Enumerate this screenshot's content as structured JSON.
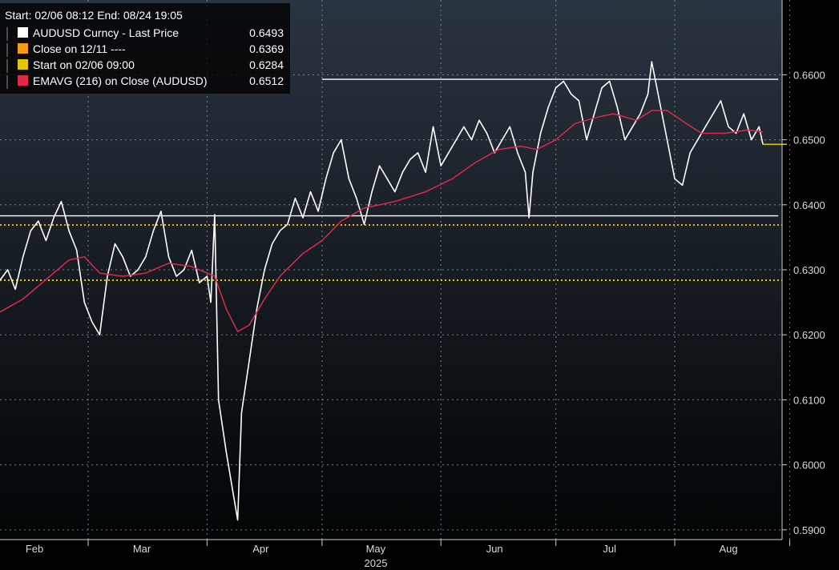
{
  "header": {
    "range_text": "Start: 02/06 08:12 End: 08/24 19:05"
  },
  "legend": {
    "items": [
      {
        "label": "AUDUSD Curncy - Last Price",
        "value": "0.6493",
        "color": "#ffffff"
      },
      {
        "label": "Close on 12/11 ----",
        "value": "0.6369",
        "color": "#f39c12"
      },
      {
        "label": "Start on 02/06 09:00",
        "value": "0.6284",
        "color": "#e5c700"
      },
      {
        "label": "EMAVG (216)  on Close (AUDUSD)",
        "value": "0.6512",
        "color": "#e0284a"
      }
    ]
  },
  "colors": {
    "price": "#ffffff",
    "ema": "#e0284a",
    "close_ref": "#f5a623",
    "start_ref": "#e5c700",
    "grid": "#8c9aa6",
    "background_top": "#2a3440",
    "background_bottom": "#020405"
  },
  "chart_data": {
    "type": "line",
    "title": "",
    "xlabel": "2025",
    "ylabel": "",
    "ylim": [
      0.5885,
      0.6715
    ],
    "x_range": [
      "2025-02-06",
      "2025-08-29"
    ],
    "grid": true,
    "legend_position": "top-left",
    "y_ticks": [
      "0.5900",
      "0.6000",
      "0.6100",
      "0.6200",
      "0.6300",
      "0.6400",
      "0.6500",
      "0.6600"
    ],
    "month_ticks": [
      {
        "label": "Feb",
        "date": "2025-02-15"
      },
      {
        "label": "Mar",
        "date": "2025-03-15"
      },
      {
        "label": "Apr",
        "date": "2025-04-15"
      },
      {
        "label": "May",
        "date": "2025-05-15"
      },
      {
        "label": "Jun",
        "date": "2025-06-15"
      },
      {
        "label": "Jul",
        "date": "2025-07-15"
      },
      {
        "label": "Aug",
        "date": "2025-08-15"
      }
    ],
    "month_dividers": [
      "2025-03-01",
      "2025-04-01",
      "2025-05-01",
      "2025-06-01",
      "2025-07-01",
      "2025-08-01",
      "2025-08-31"
    ],
    "horizontal_lines": [
      {
        "name": "resistance",
        "value": 0.6593,
        "from": "2025-05-01",
        "to": "2025-08-28",
        "style": "solid"
      },
      {
        "name": "support",
        "value": 0.6383,
        "from": "2025-02-06",
        "to": "2025-08-28",
        "style": "solid"
      },
      {
        "name": "close-ref",
        "value": 0.6369,
        "style": "dotted"
      },
      {
        "name": "start-ref",
        "value": 0.6284,
        "style": "dotted"
      }
    ],
    "last_price_marker": 0.6493,
    "series": [
      {
        "name": "AUDUSD Curncy - Last Price",
        "points": [
          [
            "2025-02-06",
            0.6284
          ],
          [
            "2025-02-08",
            0.63
          ],
          [
            "2025-02-10",
            0.627
          ],
          [
            "2025-02-12",
            0.632
          ],
          [
            "2025-02-14",
            0.636
          ],
          [
            "2025-02-16",
            0.6375
          ],
          [
            "2025-02-18",
            0.6345
          ],
          [
            "2025-02-20",
            0.638
          ],
          [
            "2025-02-22",
            0.6405
          ],
          [
            "2025-02-24",
            0.636
          ],
          [
            "2025-02-26",
            0.633
          ],
          [
            "2025-02-28",
            0.625
          ],
          [
            "2025-03-02",
            0.622
          ],
          [
            "2025-03-04",
            0.62
          ],
          [
            "2025-03-06",
            0.629
          ],
          [
            "2025-03-08",
            0.634
          ],
          [
            "2025-03-10",
            0.632
          ],
          [
            "2025-03-12",
            0.629
          ],
          [
            "2025-03-14",
            0.63
          ],
          [
            "2025-03-16",
            0.632
          ],
          [
            "2025-03-18",
            0.636
          ],
          [
            "2025-03-20",
            0.639
          ],
          [
            "2025-03-22",
            0.632
          ],
          [
            "2025-03-24",
            0.629
          ],
          [
            "2025-03-26",
            0.63
          ],
          [
            "2025-03-28",
            0.633
          ],
          [
            "2025-03-30",
            0.628
          ],
          [
            "2025-04-01",
            0.629
          ],
          [
            "2025-04-02",
            0.625
          ],
          [
            "2025-04-03",
            0.6385
          ],
          [
            "2025-04-04",
            0.61
          ],
          [
            "2025-04-06",
            0.602
          ],
          [
            "2025-04-08",
            0.595
          ],
          [
            "2025-04-09",
            0.5915
          ],
          [
            "2025-04-10",
            0.608
          ],
          [
            "2025-04-12",
            0.616
          ],
          [
            "2025-04-14",
            0.624
          ],
          [
            "2025-04-16",
            0.63
          ],
          [
            "2025-04-18",
            0.634
          ],
          [
            "2025-04-20",
            0.636
          ],
          [
            "2025-04-22",
            0.637
          ],
          [
            "2025-04-24",
            0.641
          ],
          [
            "2025-04-26",
            0.638
          ],
          [
            "2025-04-28",
            0.642
          ],
          [
            "2025-04-30",
            0.639
          ],
          [
            "2025-05-02",
            0.644
          ],
          [
            "2025-05-04",
            0.648
          ],
          [
            "2025-05-06",
            0.65
          ],
          [
            "2025-05-08",
            0.644
          ],
          [
            "2025-05-10",
            0.641
          ],
          [
            "2025-05-12",
            0.637
          ],
          [
            "2025-05-14",
            0.642
          ],
          [
            "2025-05-16",
            0.646
          ],
          [
            "2025-05-18",
            0.644
          ],
          [
            "2025-05-20",
            0.642
          ],
          [
            "2025-05-22",
            0.645
          ],
          [
            "2025-05-24",
            0.647
          ],
          [
            "2025-05-26",
            0.648
          ],
          [
            "2025-05-28",
            0.645
          ],
          [
            "2025-05-30",
            0.652
          ],
          [
            "2025-06-01",
            0.646
          ],
          [
            "2025-06-03",
            0.648
          ],
          [
            "2025-06-05",
            0.65
          ],
          [
            "2025-06-07",
            0.652
          ],
          [
            "2025-06-09",
            0.65
          ],
          [
            "2025-06-11",
            0.653
          ],
          [
            "2025-06-13",
            0.651
          ],
          [
            "2025-06-15",
            0.648
          ],
          [
            "2025-06-17",
            0.65
          ],
          [
            "2025-06-19",
            0.652
          ],
          [
            "2025-06-21",
            0.648
          ],
          [
            "2025-06-23",
            0.645
          ],
          [
            "2025-06-24",
            0.638
          ],
          [
            "2025-06-25",
            0.645
          ],
          [
            "2025-06-27",
            0.651
          ],
          [
            "2025-06-29",
            0.655
          ],
          [
            "2025-07-01",
            0.658
          ],
          [
            "2025-07-03",
            0.659
          ],
          [
            "2025-07-05",
            0.657
          ],
          [
            "2025-07-07",
            0.656
          ],
          [
            "2025-07-09",
            0.65
          ],
          [
            "2025-07-11",
            0.654
          ],
          [
            "2025-07-13",
            0.658
          ],
          [
            "2025-07-15",
            0.659
          ],
          [
            "2025-07-17",
            0.655
          ],
          [
            "2025-07-19",
            0.65
          ],
          [
            "2025-07-21",
            0.652
          ],
          [
            "2025-07-23",
            0.654
          ],
          [
            "2025-07-25",
            0.657
          ],
          [
            "2025-07-26",
            0.662
          ],
          [
            "2025-07-28",
            0.656
          ],
          [
            "2025-07-30",
            0.65
          ],
          [
            "2025-08-01",
            0.644
          ],
          [
            "2025-08-03",
            0.643
          ],
          [
            "2025-08-05",
            0.648
          ],
          [
            "2025-08-07",
            0.65
          ],
          [
            "2025-08-09",
            0.652
          ],
          [
            "2025-08-11",
            0.654
          ],
          [
            "2025-08-13",
            0.656
          ],
          [
            "2025-08-15",
            0.652
          ],
          [
            "2025-08-17",
            0.651
          ],
          [
            "2025-08-19",
            0.654
          ],
          [
            "2025-08-21",
            0.65
          ],
          [
            "2025-08-23",
            0.652
          ],
          [
            "2025-08-24",
            0.6493
          ]
        ]
      },
      {
        "name": "EMAVG (216)  on Close (AUDUSD)",
        "points": [
          [
            "2025-02-06",
            0.6235
          ],
          [
            "2025-02-12",
            0.6255
          ],
          [
            "2025-02-18",
            0.6285
          ],
          [
            "2025-02-24",
            0.6315
          ],
          [
            "2025-02-28",
            0.632
          ],
          [
            "2025-03-04",
            0.6295
          ],
          [
            "2025-03-10",
            0.629
          ],
          [
            "2025-03-16",
            0.6295
          ],
          [
            "2025-03-22",
            0.631
          ],
          [
            "2025-03-28",
            0.6305
          ],
          [
            "2025-04-01",
            0.6295
          ],
          [
            "2025-04-03",
            0.629
          ],
          [
            "2025-04-06",
            0.624
          ],
          [
            "2025-04-09",
            0.6205
          ],
          [
            "2025-04-12",
            0.6215
          ],
          [
            "2025-04-16",
            0.6255
          ],
          [
            "2025-04-20",
            0.629
          ],
          [
            "2025-04-26",
            0.6325
          ],
          [
            "2025-05-01",
            0.6345
          ],
          [
            "2025-05-06",
            0.6375
          ],
          [
            "2025-05-12",
            0.6395
          ],
          [
            "2025-05-20",
            0.6405
          ],
          [
            "2025-05-28",
            0.642
          ],
          [
            "2025-06-04",
            0.644
          ],
          [
            "2025-06-10",
            0.6465
          ],
          [
            "2025-06-16",
            0.6485
          ],
          [
            "2025-06-22",
            0.649
          ],
          [
            "2025-06-26",
            0.6485
          ],
          [
            "2025-07-01",
            0.65
          ],
          [
            "2025-07-06",
            0.6525
          ],
          [
            "2025-07-12",
            0.6535
          ],
          [
            "2025-07-16",
            0.654
          ],
          [
            "2025-07-22",
            0.653
          ],
          [
            "2025-07-26",
            0.6545
          ],
          [
            "2025-07-30",
            0.6545
          ],
          [
            "2025-08-04",
            0.6525
          ],
          [
            "2025-08-08",
            0.651
          ],
          [
            "2025-08-14",
            0.651
          ],
          [
            "2025-08-20",
            0.6515
          ],
          [
            "2025-08-24",
            0.6512
          ]
        ]
      }
    ]
  }
}
